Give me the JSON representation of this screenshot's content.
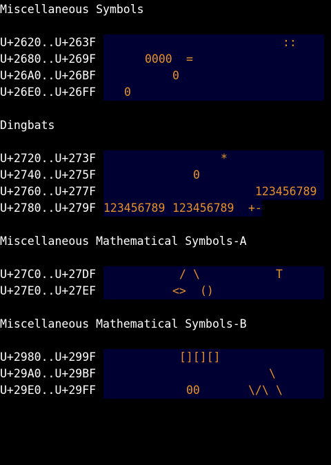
{
  "colors": {
    "background": "#000000",
    "text": "#ffffff",
    "cell_background": "#000033",
    "glyph": "#e8902a"
  },
  "sections": [
    {
      "title": "Miscellaneous Symbols",
      "rows": [
        {
          "range": "U+2620..U+263F",
          "segments": [
            {
              "text": "::",
              "col": 26
            }
          ]
        },
        {
          "range": "U+2680..U+269F",
          "segments": [
            {
              "text": "0000",
              "col": 6
            },
            {
              "text": "=",
              "col": 12
            }
          ]
        },
        {
          "range": "U+26A0..U+26BF",
          "segments": [
            {
              "text": "0",
              "col": 10
            }
          ]
        },
        {
          "range": "U+26E0..U+26FF",
          "segments": [
            {
              "text": "0",
              "col": 3
            }
          ]
        }
      ]
    },
    {
      "title": "Dingbats",
      "rows": [
        {
          "range": "U+2720..U+273F",
          "segments": [
            {
              "text": "*",
              "col": 17
            }
          ]
        },
        {
          "range": "U+2740..U+275F",
          "segments": [
            {
              "text": "0",
              "col": 13
            }
          ]
        },
        {
          "range": "U+2760..U+277F",
          "segments": [
            {
              "text": "123456789",
              "col": 22
            }
          ]
        },
        {
          "range": "U+2780..U+279F",
          "segments": [
            {
              "text": "123456789",
              "col": 0
            },
            {
              "text": "123456789",
              "col": 10
            },
            {
              "text": "+-",
              "col": 21
            }
          ]
        }
      ]
    },
    {
      "title": "Miscellaneous Mathematical Symbols-A",
      "rows": [
        {
          "range": "U+27C0..U+27DF",
          "segments": [
            {
              "text": "/",
              "col": 11
            },
            {
              "text": "\\",
              "col": 13
            },
            {
              "text": "T",
              "col": 25
            }
          ]
        },
        {
          "range": "U+27E0..U+27EF",
          "segments": [
            {
              "text": "<>",
              "col": 10
            },
            {
              "text": "()",
              "col": 14
            }
          ]
        }
      ]
    },
    {
      "title": "Miscellaneous Mathematical Symbols-B",
      "rows": [
        {
          "range": "U+2980..U+299F",
          "segments": [
            {
              "text": "[][][]",
              "col": 11
            }
          ]
        },
        {
          "range": "U+29A0..U+29BF",
          "segments": [
            {
              "text": "\\",
              "col": 24
            }
          ]
        },
        {
          "range": "U+29E0..U+29FF",
          "segments": [
            {
              "text": "00",
              "col": 12
            },
            {
              "text": "\\/\\",
              "col": 21
            },
            {
              "text": "\\",
              "col": 25
            }
          ]
        }
      ]
    }
  ]
}
